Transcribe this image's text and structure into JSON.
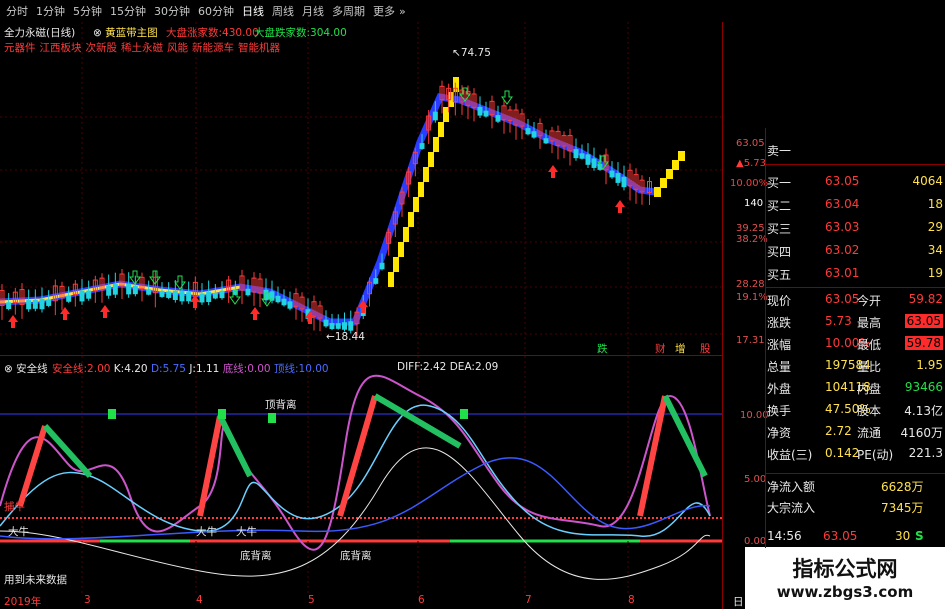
{
  "toolbar": {
    "items": [
      "分时",
      "1分钟",
      "5分钟",
      "15分钟",
      "30分钟",
      "60分钟",
      "日线",
      "周线",
      "月线",
      "多周期",
      "更多"
    ]
  },
  "main_header": {
    "stock_name": "全力永磁(日线)",
    "indicator_name": "黄蓝带主图",
    "big_inflow_label": "大盘涨家数:",
    "big_inflow_value": "430.00",
    "big_outflow_label": "大盘跌家数:",
    "big_outflow_value": "304.00",
    "concepts": [
      "元器件",
      "江西板块",
      "次新股",
      "稀土永磁",
      "风能",
      "新能源车",
      "智能机器"
    ]
  },
  "main_chart": {
    "high_label": "74.75",
    "low_label": "18.44",
    "price_scale": [
      "63.05",
      "5.73",
      "10.00%",
      "140",
      "39.25",
      "38.2%",
      "28.28",
      "19.1%",
      "17.31"
    ],
    "signals": [
      "跌",
      "财",
      "增",
      "股"
    ]
  },
  "indicator": {
    "name": "安全线",
    "params": [
      {
        "label": "安全线:",
        "value": "2.00"
      },
      {
        "label": "K:",
        "value": "4.20"
      },
      {
        "label": "D:",
        "value": "5.75"
      },
      {
        "label": "J:",
        "value": "1.11"
      },
      {
        "label": "底线:",
        "value": "0.00"
      },
      {
        "label": "顶线:",
        "value": "10.00"
      }
    ],
    "macd_diff_label": "DIFF:",
    "macd_diff": "2.42",
    "macd_dea_label": "DEA:",
    "macd_dea": "2.09",
    "annotations": {
      "top_divergence": "顶背离",
      "bottom_divergence_1": "底背离",
      "bottom_divergence_2": "底背离",
      "big_bull_1": "大牛",
      "big_bull_2": "大牛",
      "big_bull_3": "大牛",
      "future_data": "用到未来数据",
      "left_marker": "捕牛"
    },
    "scale": [
      "10.00",
      "5.00",
      "0.00"
    ]
  },
  "xaxis": {
    "labels": [
      "2019年",
      "3",
      "4",
      "5",
      "6",
      "7",
      "8"
    ],
    "right_label": "日"
  },
  "order_book": {
    "sells": [
      {
        "label": "卖一",
        "price": "",
        "vol": ""
      }
    ],
    "buys": [
      {
        "label": "买一",
        "price": "63.05",
        "vol": "4064"
      },
      {
        "label": "买二",
        "price": "63.04",
        "vol": "18"
      },
      {
        "label": "买三",
        "price": "63.03",
        "vol": "29"
      },
      {
        "label": "买四",
        "price": "63.02",
        "vol": "34"
      },
      {
        "label": "买五",
        "price": "63.01",
        "vol": "19"
      }
    ]
  },
  "quote": {
    "rows": [
      {
        "l1": "现价",
        "v1": "63.05",
        "l2": "今开",
        "v2": "59.82"
      },
      {
        "l1": "涨跌",
        "v1": "5.73",
        "l2": "最高",
        "v2": "63.05"
      },
      {
        "l1": "涨幅",
        "v1": "10.00%",
        "l2": "最低",
        "v2": "59.78"
      },
      {
        "l1": "总量",
        "v1": "197584",
        "l2": "量比",
        "v2": "1.95"
      },
      {
        "l1": "外盘",
        "v1": "104118",
        "l2": "内盘",
        "v2": "93466"
      },
      {
        "l1": "换手",
        "v1": "47.50%",
        "l2": "股本",
        "v2": "4.13亿"
      },
      {
        "l1": "净资",
        "v1": "2.72",
        "l2": "流通",
        "v2": "4160万"
      },
      {
        "l1": "收益(三)",
        "v1": "0.142",
        "l2": "PE(动)",
        "v2": "221.3"
      }
    ],
    "net_inflow_label": "净流入额",
    "net_inflow_value": "6628万",
    "block_trade_label": "大宗流入",
    "block_trade_value": "7345万"
  },
  "tick": {
    "time": "14:56",
    "price": "63.05",
    "vol": "30",
    "side": "S"
  },
  "watermark": {
    "line1": "指标公式网",
    "line2": "www.zbgs3.com"
  }
}
